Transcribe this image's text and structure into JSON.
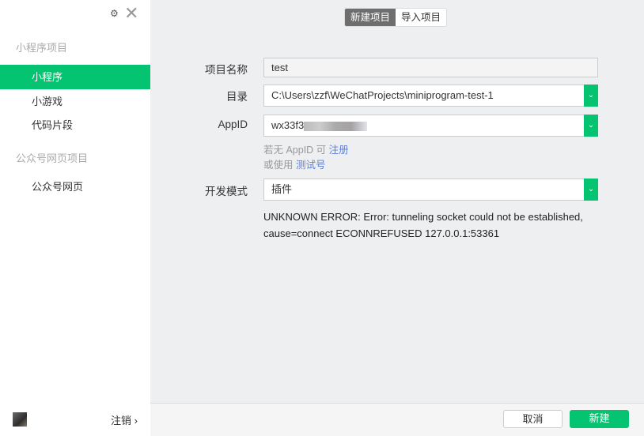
{
  "sidebar": {
    "group1": "小程序项目",
    "items": [
      "小程序",
      "小游戏",
      "代码片段"
    ],
    "group2": "公众号网页项目",
    "item_web": "公众号网页",
    "logout": "注销 ›",
    "gear": "⚙",
    "close": "✕"
  },
  "tabs": [
    "新建项目",
    "导入项目"
  ],
  "form": {
    "name_label": "项目名称",
    "name_value": "test",
    "dir_label": "目录",
    "dir_value": "C:\\Users\\zzf\\WeChatProjects\\miniprogram-test-1",
    "appid_label": "AppID",
    "appid_value": "wx33f3",
    "hint1": "若无 AppID 可 ",
    "hint1_link": "注册",
    "hint2": "或使用 ",
    "hint2_link": "测试号",
    "mode_label": "开发模式",
    "mode_value": "插件"
  },
  "error": "UNKNOWN ERROR: Error: tunneling socket could not be established, cause=connect ECONNREFUSED 127.0.0.1:53361",
  "footer": {
    "cancel": "取消",
    "create": "新建"
  }
}
